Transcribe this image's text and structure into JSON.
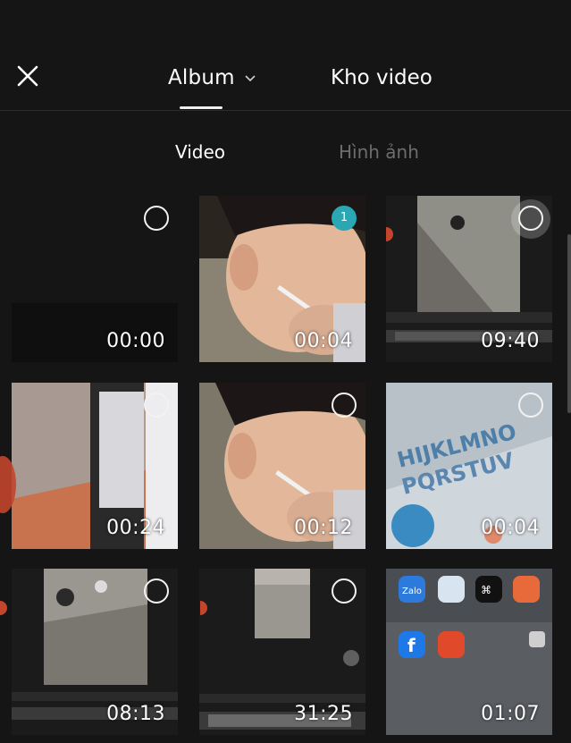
{
  "header": {
    "album_label": "Album",
    "kho_video_label": "Kho video"
  },
  "subtabs": {
    "video_label": "Video",
    "image_label": "Hình ảnh"
  },
  "grid": {
    "items": [
      {
        "duration": "00:00",
        "selected": false
      },
      {
        "duration": "00:04",
        "selected": true,
        "selection_number": "1"
      },
      {
        "duration": "09:40",
        "selected": false
      },
      {
        "duration": "00:24",
        "selected": false
      },
      {
        "duration": "00:12",
        "selected": false
      },
      {
        "duration": "00:04",
        "selected": false
      },
      {
        "duration": "08:13",
        "selected": false
      },
      {
        "duration": "31:25",
        "selected": false
      },
      {
        "duration": "01:07",
        "selected": false
      }
    ]
  },
  "phone_apps": [
    {
      "name": "Zalo",
      "label": "Zalo"
    },
    {
      "name": "CapCut",
      "label": "CapCut"
    },
    {
      "name": "Facebook",
      "label": "f"
    }
  ],
  "colors": {
    "background": "#151515",
    "selection_badge": "#2aa7b2",
    "inactive_tab": "#6d6d6d"
  }
}
